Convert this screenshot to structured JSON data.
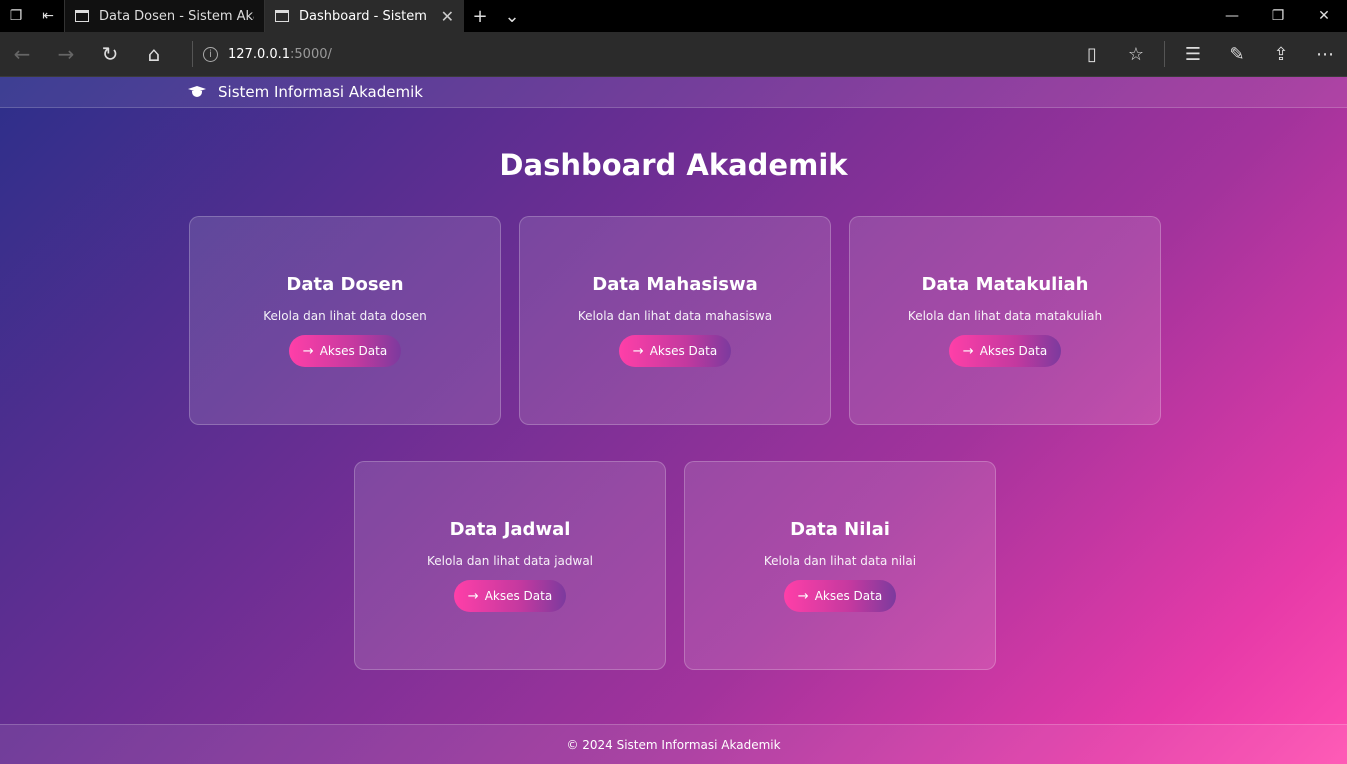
{
  "browser": {
    "tabs": [
      {
        "title": "Data Dosen - Sistem Akademik"
      },
      {
        "title": "Dashboard - Sistem Akademik"
      }
    ],
    "address": {
      "host": "127.0.0.1",
      "path": ":5000/"
    }
  },
  "site": {
    "brand": "Sistem Informasi Akademik",
    "page_title": "Dashboard Akademik",
    "cards": [
      {
        "title": "Data Dosen",
        "desc": "Kelola dan lihat data dosen",
        "button": "Akses Data"
      },
      {
        "title": "Data Mahasiswa",
        "desc": "Kelola dan lihat data mahasiswa",
        "button": "Akses Data"
      },
      {
        "title": "Data Matakuliah",
        "desc": "Kelola dan lihat data matakuliah",
        "button": "Akses Data"
      },
      {
        "title": "Data Jadwal",
        "desc": "Kelola dan lihat data jadwal",
        "button": "Akses Data"
      },
      {
        "title": "Data Nilai",
        "desc": "Kelola dan lihat data nilai",
        "button": "Akses Data"
      }
    ],
    "footer": "© 2024 Sistem Informasi Akademik"
  }
}
